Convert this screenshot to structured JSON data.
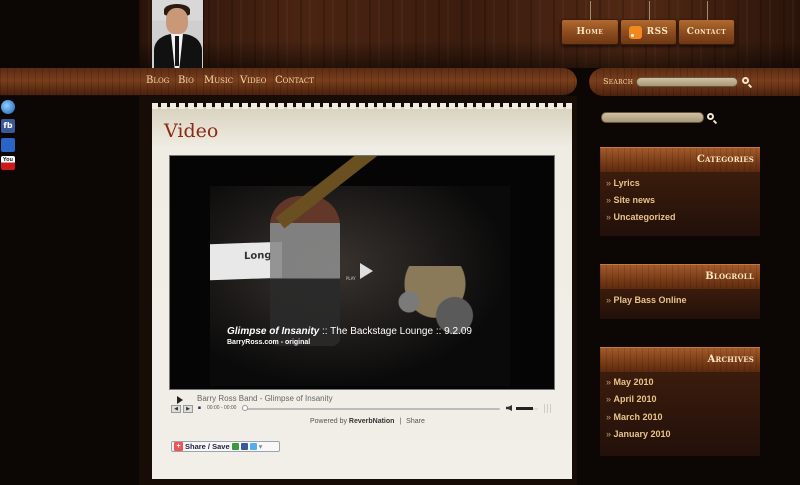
{
  "header": {
    "buttons": [
      {
        "label": "Home"
      },
      {
        "label": "RSS"
      },
      {
        "label": "Contact"
      }
    ]
  },
  "nav": {
    "items": [
      "Blog",
      "Bio",
      "Music",
      "Video",
      "Contact"
    ],
    "search_label": "Search"
  },
  "social": [
    {
      "name": "ie"
    },
    {
      "name": "facebook"
    },
    {
      "name": "myspace"
    },
    {
      "name": "youtube"
    }
  ],
  "page": {
    "title": "Video"
  },
  "video": {
    "caption_title": "Glimpse of Insanity",
    "caption_rest": " :: The Backstage Lounge :: 9.2.09",
    "caption_sub": "BarryRoss.com - original",
    "banner_text": "Long",
    "play_label": "PLAY"
  },
  "audio": {
    "title": "Barry Ross Band - Glimpse of Insanity",
    "time": "00:00 - 00:00",
    "progress": 0.0,
    "volume": 0.75
  },
  "powered": {
    "prefix": "Powered by ",
    "brand": "ReverbNation",
    "separator": "|",
    "share": "Share"
  },
  "share_button": {
    "label": "Share / Save"
  },
  "sidebar": {
    "search_placeholder": "",
    "categories": {
      "title": "Categories",
      "items": [
        "Lyrics",
        "Site news",
        "Uncategorized"
      ]
    },
    "blogroll": {
      "title": "Blogroll",
      "items": [
        "Play Bass Online"
      ]
    },
    "archives": {
      "title": "Archives",
      "items": [
        "May 2010",
        "April 2010",
        "March 2010",
        "January 2010"
      ]
    }
  },
  "colors": {
    "title_red": "#8a2a14",
    "link_gold": "#e9c48a",
    "wood_dark": "#2a140a"
  }
}
